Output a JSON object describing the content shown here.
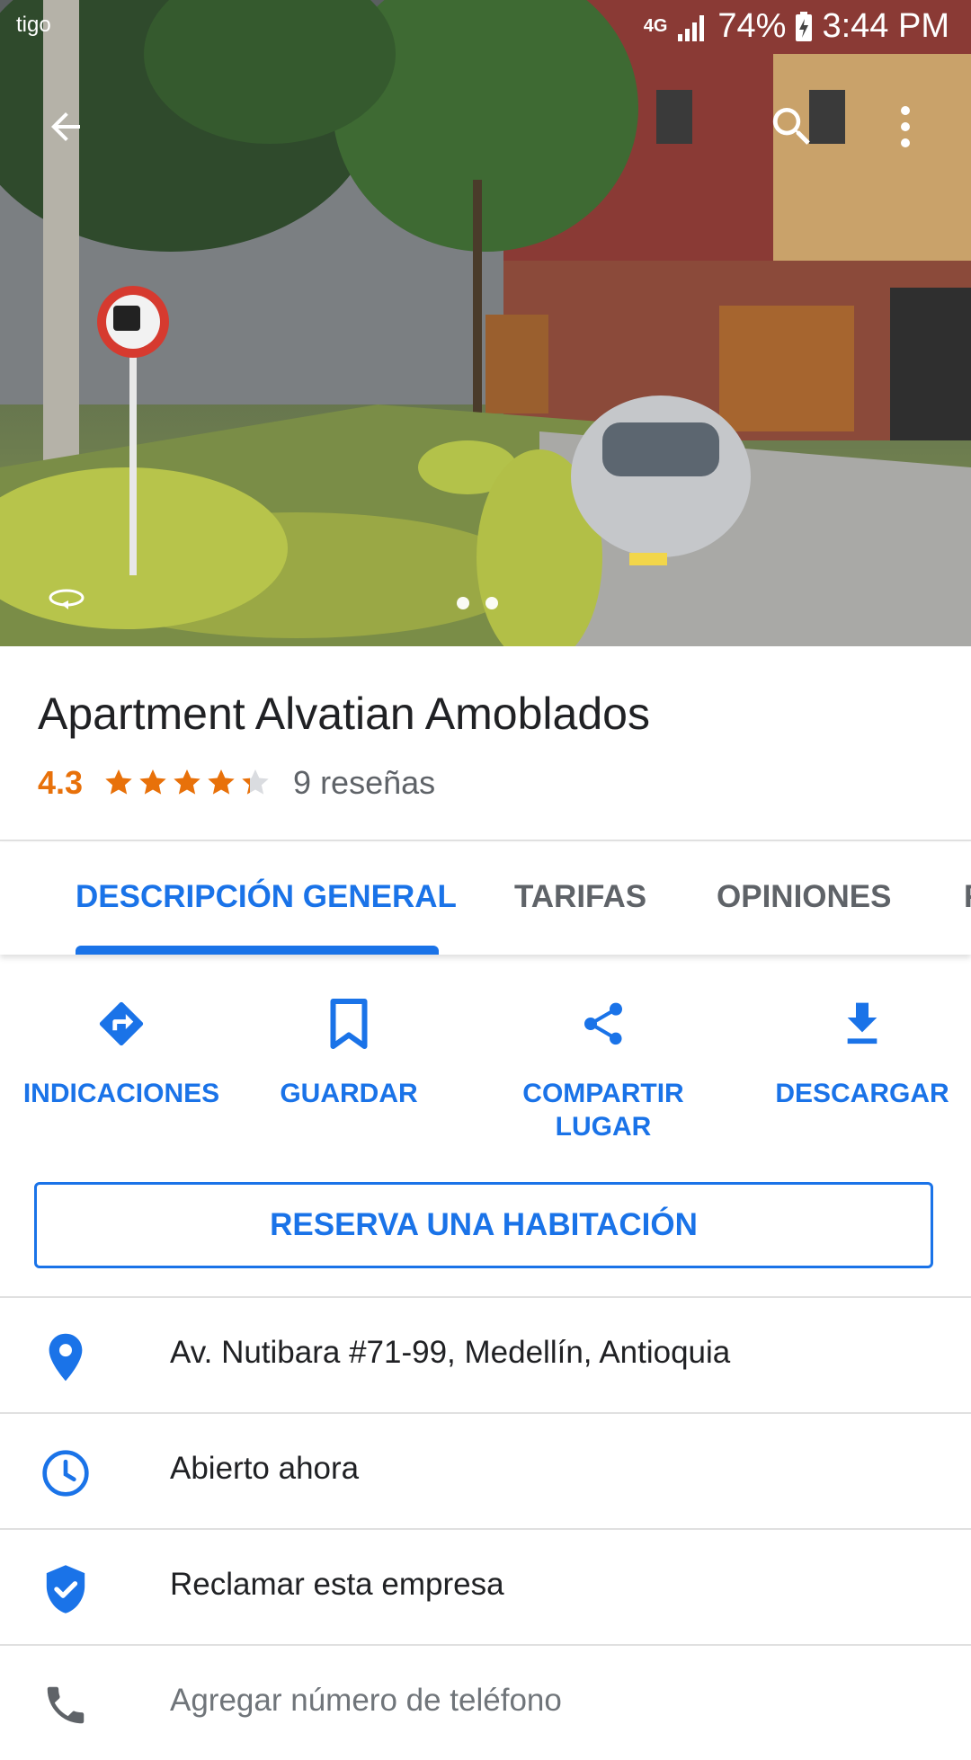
{
  "status_bar": {
    "carrier": "tigo",
    "network": "4G",
    "battery": "74%",
    "time": "3:44 PM"
  },
  "hero": {
    "photo_count": 2,
    "active_photo": 1,
    "back_icon": "arrow-back-icon",
    "search_icon": "search-icon",
    "menu_icon": "more-vert-icon",
    "rotate_icon": "street-view-rotate-icon"
  },
  "place": {
    "title": "Apartment Alvatian Amoblados",
    "rating": "4.3",
    "rating_value": 4.3,
    "reviews": "9 reseñas"
  },
  "tabs": [
    {
      "label": "DESCRIPCIÓN GENERAL",
      "active": true
    },
    {
      "label": "TARIFAS",
      "active": false
    },
    {
      "label": "OPINIONES",
      "active": false
    },
    {
      "label": "F",
      "active": false
    }
  ],
  "actions": [
    {
      "label": "INDICACIONES",
      "icon": "directions-icon"
    },
    {
      "label": "GUARDAR",
      "icon": "bookmark-icon"
    },
    {
      "label_line1": "COMPARTIR",
      "label_line2": "LUGAR",
      "icon": "share-icon"
    },
    {
      "label": "DESCARGAR",
      "icon": "download-icon"
    }
  ],
  "reserve_button": "RESERVA UNA HABITACIÓN",
  "info_rows": [
    {
      "text": "Av. Nutibara #71-99, Medellín, Antioquia",
      "icon": "location-pin-icon"
    },
    {
      "text": "Abierto ahora",
      "icon": "clock-icon"
    },
    {
      "text": "Reclamar esta empresa",
      "icon": "verified-shield-icon"
    },
    {
      "text": "Agregar número de teléfono",
      "icon": "phone-icon"
    }
  ],
  "colors": {
    "accent": "#1a73e8",
    "rating": "#e8710a",
    "text": "#202124",
    "muted": "#70757a"
  }
}
